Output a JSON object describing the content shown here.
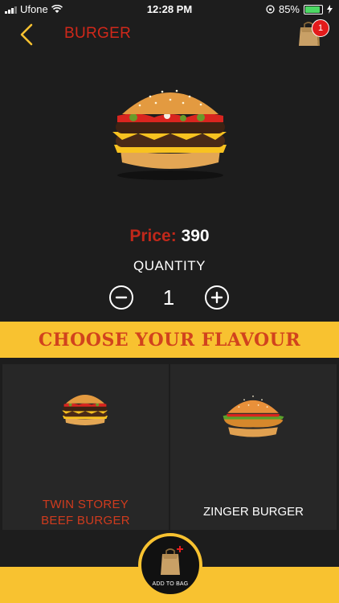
{
  "status_bar": {
    "carrier": "Ufone",
    "time": "12:28 PM",
    "battery": "85%",
    "battery_level": 0.85
  },
  "header": {
    "title": "BURGER",
    "cart_count": "1"
  },
  "product": {
    "price_label": "Price:",
    "price_value": "390"
  },
  "quantity": {
    "label": "QUANTITY",
    "value": "1"
  },
  "flavour": {
    "title": "CHOOSE YOUR FLAVOUR",
    "options": [
      {
        "line1": "TWIN STOREY",
        "line2": "BEEF  BURGER"
      },
      {
        "line1": "ZINGER BURGER"
      }
    ]
  },
  "footer": {
    "add_to_bag": "ADD TO BAG"
  },
  "colors": {
    "background": "#1d1d1d",
    "accent_yellow": "#f8c230",
    "accent_red": "#c0281a"
  }
}
